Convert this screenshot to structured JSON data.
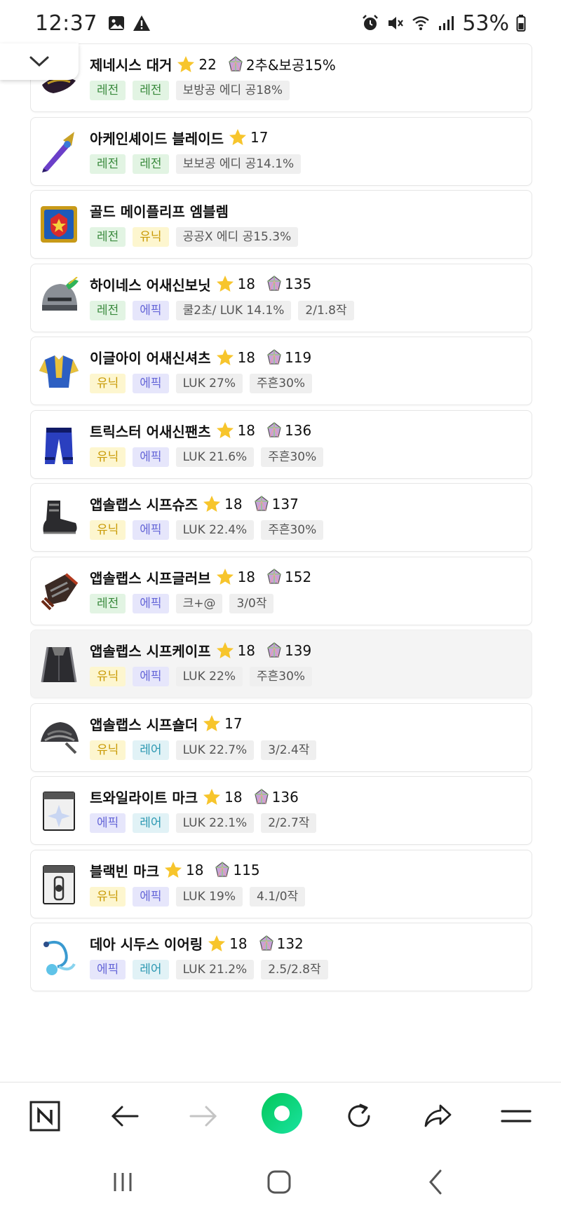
{
  "status_bar": {
    "time": "12:37",
    "left_icons": [
      "image-icon",
      "warning-icon"
    ],
    "right_icons": [
      "alarm-icon",
      "mute-icon",
      "wifi-icon",
      "signal-icon"
    ],
    "battery_pct": "53%"
  },
  "items": [
    {
      "name": "제네시스 대거",
      "stars": "22",
      "gem": "2추&보공15%",
      "tags": [
        {
          "text": "레전",
          "type": "legend"
        },
        {
          "text": "레전",
          "type": "legend"
        },
        {
          "text": "보방공 에디 공18%",
          "type": "text"
        }
      ],
      "icon": "dagger-icon",
      "selected": false
    },
    {
      "name": "아케인셰이드 블레이드",
      "stars": "17",
      "gem": "",
      "tags": [
        {
          "text": "레전",
          "type": "legend"
        },
        {
          "text": "레전",
          "type": "legend"
        },
        {
          "text": "보보공 에디 공14.1%",
          "type": "text"
        }
      ],
      "icon": "blade-icon",
      "selected": false
    },
    {
      "name": "골드 메이플리프 엠블렘",
      "stars": "",
      "gem": "",
      "tags": [
        {
          "text": "레전",
          "type": "legend"
        },
        {
          "text": "유닉",
          "type": "unique"
        },
        {
          "text": "공공X 에디 공15.3%",
          "type": "text"
        }
      ],
      "icon": "emblem-icon",
      "selected": false
    },
    {
      "name": "하이네스 어새신보닛",
      "stars": "18",
      "gem": "135",
      "tags": [
        {
          "text": "레전",
          "type": "legend"
        },
        {
          "text": "에픽",
          "type": "epic"
        },
        {
          "text": "쿨2초/ LUK 14.1%",
          "type": "text"
        },
        {
          "text": "2/1.8작",
          "type": "text"
        }
      ],
      "icon": "helmet-icon",
      "selected": false
    },
    {
      "name": "이글아이 어새신셔츠",
      "stars": "18",
      "gem": "119",
      "tags": [
        {
          "text": "유닉",
          "type": "unique"
        },
        {
          "text": "에픽",
          "type": "epic"
        },
        {
          "text": "LUK 27%",
          "type": "text"
        },
        {
          "text": "주흔30%",
          "type": "text"
        }
      ],
      "icon": "shirt-icon",
      "selected": false
    },
    {
      "name": "트릭스터 어새신팬츠",
      "stars": "18",
      "gem": "136",
      "tags": [
        {
          "text": "유닉",
          "type": "unique"
        },
        {
          "text": "에픽",
          "type": "epic"
        },
        {
          "text": "LUK 21.6%",
          "type": "text"
        },
        {
          "text": "주흔30%",
          "type": "text"
        }
      ],
      "icon": "pants-icon",
      "selected": false
    },
    {
      "name": "앱솔랩스 시프슈즈",
      "stars": "18",
      "gem": "137",
      "tags": [
        {
          "text": "유닉",
          "type": "unique"
        },
        {
          "text": "에픽",
          "type": "epic"
        },
        {
          "text": "LUK 22.4%",
          "type": "text"
        },
        {
          "text": "주흔30%",
          "type": "text"
        }
      ],
      "icon": "shoes-icon",
      "selected": false
    },
    {
      "name": "앱솔랩스 시프글러브",
      "stars": "18",
      "gem": "152",
      "tags": [
        {
          "text": "레전",
          "type": "legend"
        },
        {
          "text": "에픽",
          "type": "epic"
        },
        {
          "text": "크+@",
          "type": "text"
        },
        {
          "text": "3/0작",
          "type": "text"
        }
      ],
      "icon": "glove-icon",
      "selected": false
    },
    {
      "name": "앱솔랩스 시프케이프",
      "stars": "18",
      "gem": "139",
      "tags": [
        {
          "text": "유닉",
          "type": "unique"
        },
        {
          "text": "에픽",
          "type": "epic"
        },
        {
          "text": "LUK 22%",
          "type": "text"
        },
        {
          "text": "주흔30%",
          "type": "text"
        }
      ],
      "icon": "cape-icon",
      "selected": true
    },
    {
      "name": "앱솔랩스 시프숄더",
      "stars": "17",
      "gem": "",
      "tags": [
        {
          "text": "유닉",
          "type": "unique"
        },
        {
          "text": "레어",
          "type": "rare"
        },
        {
          "text": "LUK 22.7%",
          "type": "text"
        },
        {
          "text": "3/2.4작",
          "type": "text"
        }
      ],
      "icon": "shoulder-icon",
      "selected": false
    },
    {
      "name": "트와일라이트 마크",
      "stars": "18",
      "gem": "136",
      "tags": [
        {
          "text": "에픽",
          "type": "epic"
        },
        {
          "text": "레어",
          "type": "rare"
        },
        {
          "text": "LUK 22.1%",
          "type": "text"
        },
        {
          "text": "2/2.7작",
          "type": "text"
        }
      ],
      "icon": "mark-icon",
      "selected": false
    },
    {
      "name": "블랙빈 마크",
      "stars": "18",
      "gem": "115",
      "tags": [
        {
          "text": "유닉",
          "type": "unique"
        },
        {
          "text": "에픽",
          "type": "epic"
        },
        {
          "text": "LUK 19%",
          "type": "text"
        },
        {
          "text": "4.1/0작",
          "type": "text"
        }
      ],
      "icon": "blackbean-mark-icon",
      "selected": false
    },
    {
      "name": "데아 시두스 이어링",
      "stars": "18",
      "gem": "132",
      "tags": [
        {
          "text": "에픽",
          "type": "epic"
        },
        {
          "text": "레어",
          "type": "rare"
        },
        {
          "text": "LUK 21.2%",
          "type": "text"
        },
        {
          "text": "2.5/2.8작",
          "type": "text"
        }
      ],
      "icon": "earring-icon",
      "selected": false
    }
  ],
  "toolbar": {
    "buttons": [
      "naver-home-icon",
      "back-arrow-icon",
      "forward-arrow-icon",
      "green-dot-icon",
      "refresh-icon",
      "share-icon",
      "menu-icon"
    ],
    "forward_disabled": true,
    "accent": "#03cf5d"
  },
  "navbar": {
    "buttons": [
      "recent-apps-icon",
      "home-icon",
      "back-icon"
    ]
  }
}
